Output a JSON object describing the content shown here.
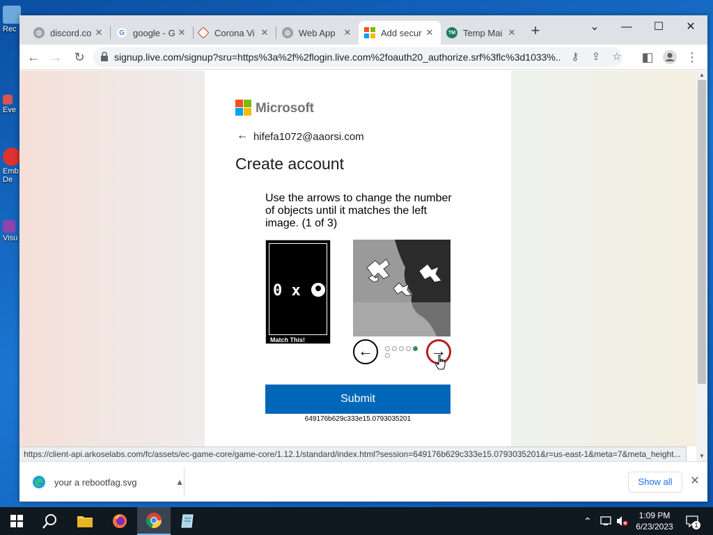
{
  "desktop": {
    "icons": [
      {
        "label": "Rec",
        "color": "#6fa8dc"
      },
      {
        "label": "Eve",
        "color": "#d9534f"
      },
      {
        "label": "Emb",
        "label2": "De",
        "color": "#e03131"
      },
      {
        "label": "Visu",
        "color": "#8e44ad"
      }
    ]
  },
  "browser": {
    "tabs": [
      {
        "title": "discord.co",
        "favicon": "globe-icon",
        "active": false
      },
      {
        "title": "google - G",
        "favicon": "google-icon",
        "active": false
      },
      {
        "title": "Corona Vi",
        "favicon": "corona-icon",
        "active": false
      },
      {
        "title": "Web App",
        "favicon": "globe-icon",
        "active": false
      },
      {
        "title": "Add secur",
        "favicon": "microsoft-icon",
        "active": true
      },
      {
        "title": "Temp Mai",
        "favicon": "tempmail-icon",
        "active": false
      }
    ],
    "url": "signup.live.com/signup?sru=https%3a%2f%2flogin.live.com%2foauth20_authorize.srf%3flc%3d1033%...",
    "status_url": "https://client-api.arkoselabs.com/fc/assets/ec-game-core/game-core/1.12.1/standard/index.html?session=649176b629c333e15.0793035201&r=us-east-1&meta=7&meta_height..."
  },
  "page": {
    "brand": "Microsoft",
    "email": "hifefa1072@aaorsi.com",
    "heading": "Create account",
    "instruction": "Use the arrows to change the number of objects until it matches the left image. (1 of 3)",
    "reference_text": "0 x",
    "match_label": "Match This!",
    "dots_total": 6,
    "dots_selected_index": 4,
    "submit_label": "Submit",
    "session_id": "649176b629c333e15.0793035201"
  },
  "download": {
    "filename": "your a rebootfag.svg",
    "show_all": "Show all"
  },
  "taskbar": {
    "time": "1:09 PM",
    "date": "6/23/2023",
    "notification_count": "1"
  },
  "colors": {
    "submit": "#0067b8",
    "ms_red": "#f25022",
    "ms_green": "#7fba00",
    "ms_blue": "#00a4ef",
    "ms_yellow": "#ffb900"
  }
}
